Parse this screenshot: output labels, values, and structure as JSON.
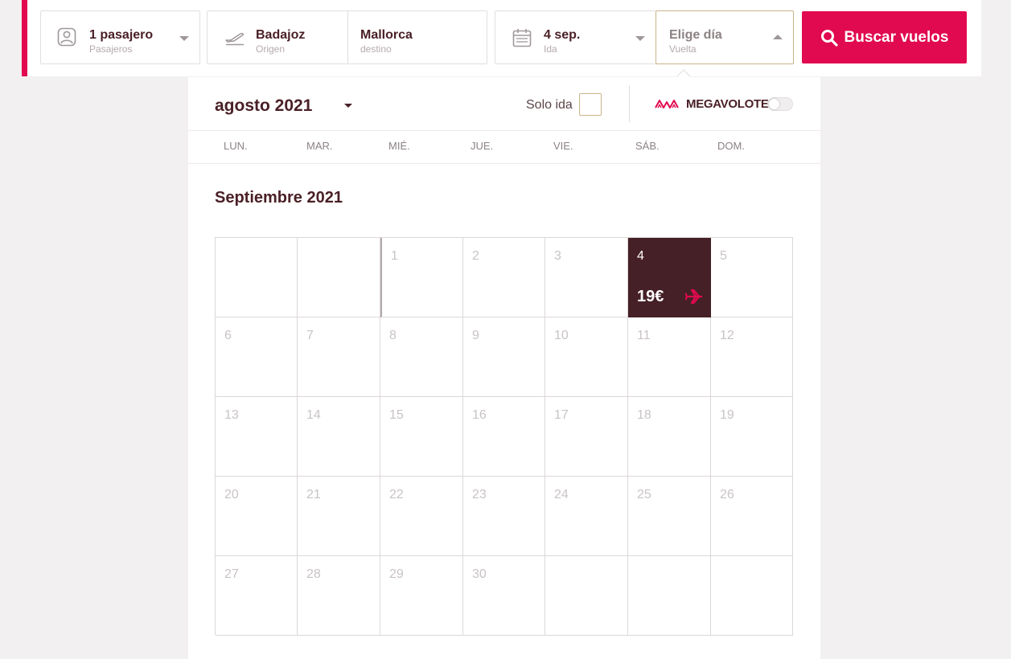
{
  "search": {
    "passengers": {
      "value": "1 pasajero",
      "label": "Pasajeros"
    },
    "origin": {
      "value": "Badajoz",
      "label": "Origen"
    },
    "destination": {
      "value": "Mallorca",
      "label": "destino"
    },
    "outbound": {
      "value": "4 sep.",
      "label": "Ida"
    },
    "return": {
      "value": "Elige día",
      "label": "Vuelta"
    },
    "search_button": "Buscar vuelos"
  },
  "calendar": {
    "month_select": "agosto 2021",
    "solo_ida": "Solo ida",
    "megavolotea": "MEGAVOLOTEA",
    "weekdays": [
      "LUN.",
      "MAR.",
      "MIÉ.",
      "JUE.",
      "VIE.",
      "SÁB.",
      "DOM."
    ],
    "month_title": "Septiembre 2021",
    "days": [
      "",
      "",
      "1",
      "2",
      "3",
      "4",
      "5",
      "6",
      "7",
      "8",
      "9",
      "10",
      "11",
      "12",
      "13",
      "14",
      "15",
      "16",
      "17",
      "18",
      "19",
      "20",
      "21",
      "22",
      "23",
      "24",
      "25",
      "26",
      "27",
      "28",
      "29",
      "30",
      "",
      "",
      ""
    ],
    "selected_day": "4",
    "selected_price": "19€"
  },
  "colors": {
    "brand": "#e1094f",
    "selected_bg": "#452026",
    "text": "#4a2026"
  },
  "icons": {
    "passengers": "person-icon",
    "origin": "plane-takeoff-icon",
    "date": "calendar-icon",
    "search": "search-icon",
    "megavolotea": "megavolotea-logo",
    "plane": "plane-icon"
  }
}
